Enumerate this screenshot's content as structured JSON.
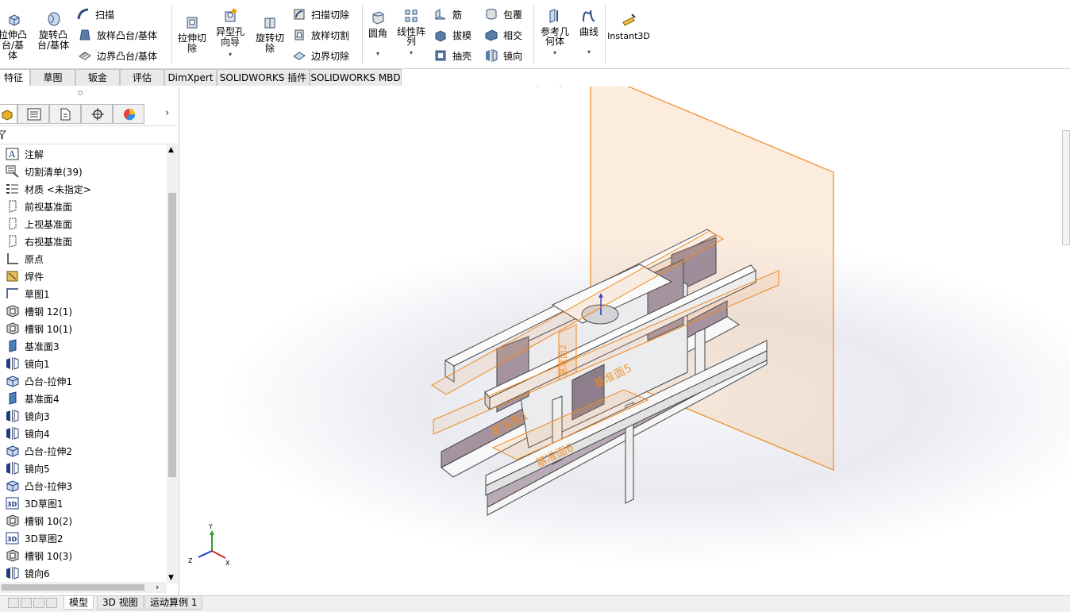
{
  "ribbon": {
    "extrude_boss": "拉伸凸台/基体",
    "revolve_boss": "旋转凸台/基体",
    "sweep": "扫描",
    "loft_boss": "放样凸台/基体",
    "boundary_boss": "边界凸台/基体",
    "extrude_cut": "拉伸切除",
    "hole_wizard": "异型孔向导",
    "revolve_cut": "旋转切除",
    "sweep_cut": "扫描切除",
    "loft_cut": "放样切割",
    "boundary_cut": "边界切除",
    "fillet": "圆角",
    "linear_pattern": "线性阵列",
    "rib": "筋",
    "draft": "拔模",
    "shell": "抽壳",
    "wrap": "包覆",
    "intersect": "相交",
    "mirror": "镜向",
    "ref_geometry": "参考几何体",
    "curves": "曲线",
    "instant3d": "Instant3D"
  },
  "tabs": [
    {
      "label": "特征"
    },
    {
      "label": "草图"
    },
    {
      "label": "钣金"
    },
    {
      "label": "评估"
    },
    {
      "label": "DimXpert"
    },
    {
      "label": "SOLIDWORKS 插件"
    },
    {
      "label": "SOLIDWORKS MBD"
    }
  ],
  "tree": [
    {
      "label": "注解",
      "icon": "annotation-icon"
    },
    {
      "label": "切割清单(39)",
      "icon": "cut-list-icon"
    },
    {
      "label": "材质 <未指定>",
      "icon": "material-icon"
    },
    {
      "label": "前视基准面",
      "icon": "plane-icon"
    },
    {
      "label": "上视基准面",
      "icon": "plane-icon"
    },
    {
      "label": "右视基准面",
      "icon": "plane-icon"
    },
    {
      "label": "原点",
      "icon": "origin-icon"
    },
    {
      "label": "焊件",
      "icon": "weldment-icon"
    },
    {
      "label": "草图1",
      "icon": "sketch-icon"
    },
    {
      "label": "槽钢 12(1)",
      "icon": "structural-member-icon"
    },
    {
      "label": "槽钢 10(1)",
      "icon": "structural-member-icon"
    },
    {
      "label": "基准面3",
      "icon": "plane-feature-icon"
    },
    {
      "label": "镜向1",
      "icon": "mirror-icon"
    },
    {
      "label": "凸台-拉伸1",
      "icon": "boss-extrude-icon"
    },
    {
      "label": "基准面4",
      "icon": "plane-feature-icon"
    },
    {
      "label": "镜向3",
      "icon": "mirror-icon"
    },
    {
      "label": "镜向4",
      "icon": "mirror-icon"
    },
    {
      "label": "凸台-拉伸2",
      "icon": "boss-extrude-icon"
    },
    {
      "label": "镜向5",
      "icon": "mirror-icon"
    },
    {
      "label": "凸台-拉伸3",
      "icon": "boss-extrude-icon"
    },
    {
      "label": "3D草图1",
      "icon": "3d-sketch-icon"
    },
    {
      "label": "槽钢 10(2)",
      "icon": "structural-member-icon"
    },
    {
      "label": "3D草图2",
      "icon": "3d-sketch-icon"
    },
    {
      "label": "槽钢 10(3)",
      "icon": "structural-member-icon"
    },
    {
      "label": "镜向6",
      "icon": "mirror-icon"
    }
  ],
  "viewport": {
    "plane_labels": [
      "基准面1",
      "基准面6",
      "基准面5",
      "基准面2"
    ],
    "triad": {
      "x": "X",
      "y": "Y",
      "z": "Z"
    }
  },
  "bottom_tabs": [
    {
      "label": "模型"
    },
    {
      "label": "3D 视图"
    },
    {
      "label": "运动算例 1"
    }
  ],
  "colors": {
    "plane": "#f4a460",
    "plane_edge": "#ee8a1e",
    "steel_top": "#f7f7f7",
    "steel_face": "#9e8e9b",
    "steel_edge": "#444444"
  }
}
